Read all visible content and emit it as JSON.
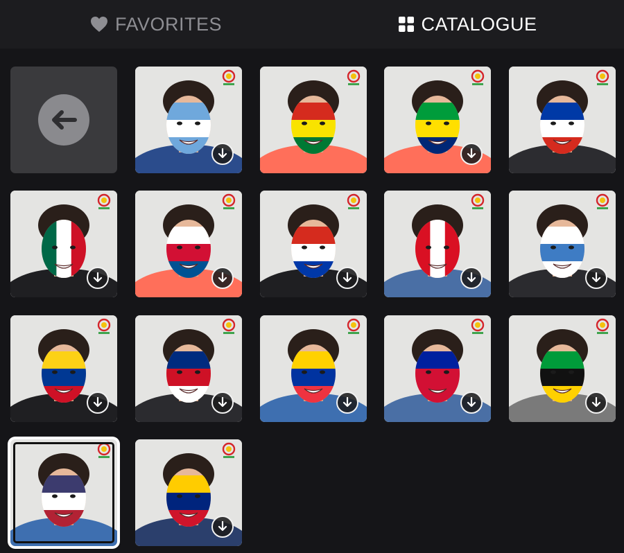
{
  "tabs": {
    "favorites": {
      "label": "FAVORITES",
      "icon": "heart-icon"
    },
    "catalogue": {
      "label": "CATALOGUE",
      "icon": "grid-icon",
      "active": true
    }
  },
  "grid": {
    "back_icon": "arrow-left-icon",
    "masks": [
      {
        "name": "Argentina",
        "stripes": [
          "#6fa8dc",
          "#ffffff",
          "#6fa8dc"
        ],
        "shirt": "#2b4c8c",
        "downloadable": true
      },
      {
        "name": "Bolivia",
        "stripes": [
          "#d52b1e",
          "#f9e300",
          "#007934"
        ],
        "shirt": "#ff6f5a",
        "downloadable": false
      },
      {
        "name": "Brazil",
        "stripes": [
          "#009c3b",
          "#ffdf00",
          "#002776"
        ],
        "shirt": "#ff6f5a",
        "downloadable": true
      },
      {
        "name": "Chile",
        "stripes": [
          "#0039a6",
          "#ffffff",
          "#d52b1e"
        ],
        "shirt": "#2c2c30",
        "downloadable": false
      },
      {
        "name": "Mexico",
        "stripes": [
          "#006847",
          "#ffffff",
          "#ce1126"
        ],
        "shirt": "#1f1f22",
        "vertical": true,
        "downloadable": true
      },
      {
        "name": "Panama",
        "stripes": [
          "#ffffff",
          "#d21034",
          "#005293"
        ],
        "shirt": "#ff6f5a",
        "downloadable": true
      },
      {
        "name": "Paraguay",
        "stripes": [
          "#d52b1e",
          "#ffffff",
          "#0038a8"
        ],
        "shirt": "#1f1f22",
        "downloadable": true
      },
      {
        "name": "Peru",
        "stripes": [
          "#d91023",
          "#ffffff",
          "#d91023"
        ],
        "shirt": "#4a6fa5",
        "vertical": true,
        "downloadable": true
      },
      {
        "name": "Uruguay",
        "stripes": [
          "#ffffff",
          "#3e7cc4",
          "#ffffff"
        ],
        "shirt": "#2b2b2f",
        "downloadable": true
      },
      {
        "name": "Colombia",
        "stripes": [
          "#fcd116",
          "#003893",
          "#ce1126"
        ],
        "shirt": "#1f1f22",
        "downloadable": true
      },
      {
        "name": "Costa Rica",
        "stripes": [
          "#002b7f",
          "#ce1126",
          "#ffffff"
        ],
        "shirt": "#2b2b2f",
        "downloadable": true
      },
      {
        "name": "Ecuador",
        "stripes": [
          "#ffd100",
          "#0033a0",
          "#ef3340"
        ],
        "shirt": "#3e6fb0",
        "downloadable": true
      },
      {
        "name": "Haiti",
        "stripes": [
          "#00209f",
          "#d21034",
          "#d21034"
        ],
        "shirt": "#4a6fa5",
        "downloadable": true
      },
      {
        "name": "Jamaica",
        "stripes": [
          "#009b3a",
          "#111111",
          "#fed100"
        ],
        "shirt": "#7a7a7a",
        "downloadable": true
      },
      {
        "name": "USA",
        "stripes": [
          "#3c3b6e",
          "#ffffff",
          "#b22234"
        ],
        "shirt": "#3e6fb0",
        "selected": true,
        "downloadable": false
      },
      {
        "name": "Venezuela",
        "stripes": [
          "#ffcc00",
          "#00247d",
          "#cf142b"
        ],
        "shirt": "#2b3f6c",
        "downloadable": true
      }
    ]
  }
}
